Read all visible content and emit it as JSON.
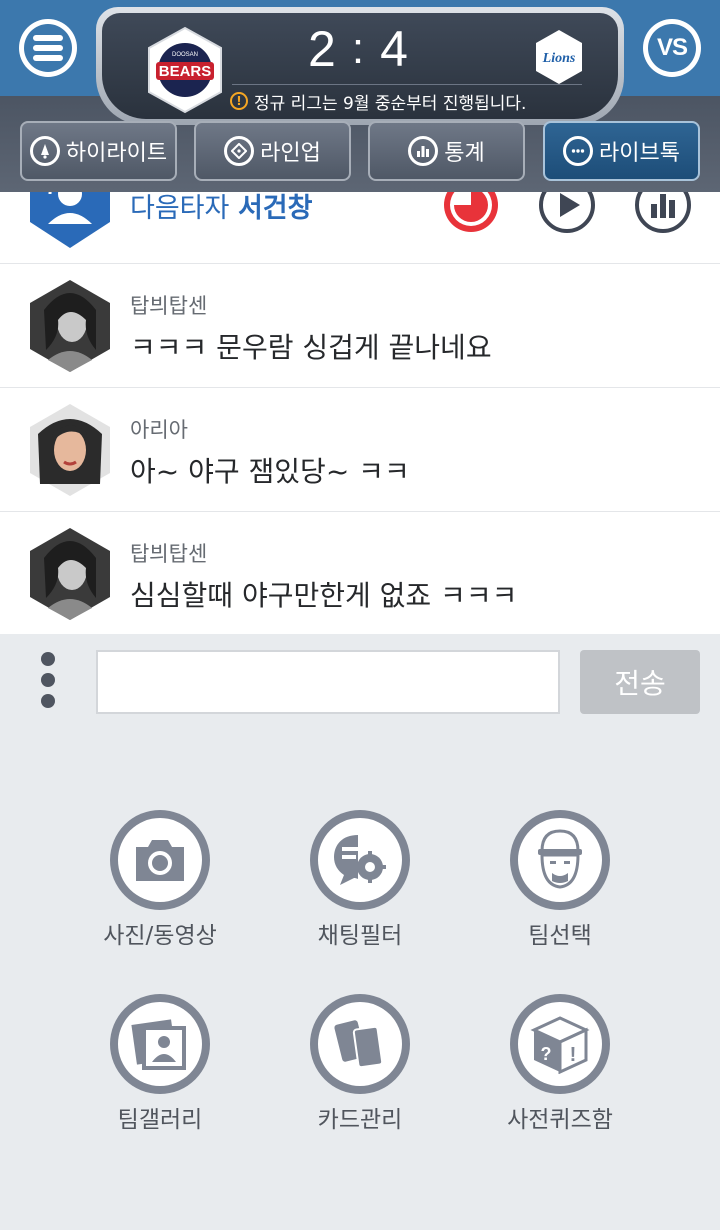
{
  "header": {
    "score": {
      "home": "2",
      "away": "4",
      "separator": ":"
    },
    "home_team": "BEARS",
    "home_team_city": "DOOSAN",
    "away_team": "Lions",
    "notice": "정규 리그는 9월 중순부터 진행됩니다.",
    "vs_label": "VS"
  },
  "tabs": [
    {
      "label": "하이라이트",
      "icon": "bell-icon"
    },
    {
      "label": "라인업",
      "icon": "diamond-field-icon"
    },
    {
      "label": "통계",
      "icon": "bar-chart-icon"
    },
    {
      "label": "라이브톡",
      "icon": "chat-bubble-icon",
      "active": true
    }
  ],
  "next_batter": {
    "prefix": "다음타자",
    "name": "서건창"
  },
  "chat": [
    {
      "user": "탑븨탑센",
      "message": "ㅋㅋㅋ 문우람 싱겁게 끝나네요"
    },
    {
      "user": "아리아",
      "message": "아~ 야구 잼있당~ ㅋㅋ"
    },
    {
      "user": "탑븨탑센",
      "message": "심심할때 야구만한게 없죠 ㅋㅋㅋ"
    }
  ],
  "input": {
    "value": "",
    "send_label": "전송"
  },
  "menu": [
    {
      "label": "사진/동영상",
      "icon": "camera-icon"
    },
    {
      "label": "채팅필터",
      "icon": "chat-filter-gear-icon"
    },
    {
      "label": "팀선택",
      "icon": "player-face-icon"
    },
    {
      "label": "팀갤러리",
      "icon": "gallery-icon"
    },
    {
      "label": "카드관리",
      "icon": "cards-icon"
    },
    {
      "label": "사전퀴즈함",
      "icon": "quiz-box-icon"
    }
  ],
  "colors": {
    "header_blue": "#3c78ad",
    "active_tab": "#2f6594",
    "batter_text": "#2a6ab8",
    "icon_gray": "#7f8694",
    "alert_red": "#e8333a"
  }
}
